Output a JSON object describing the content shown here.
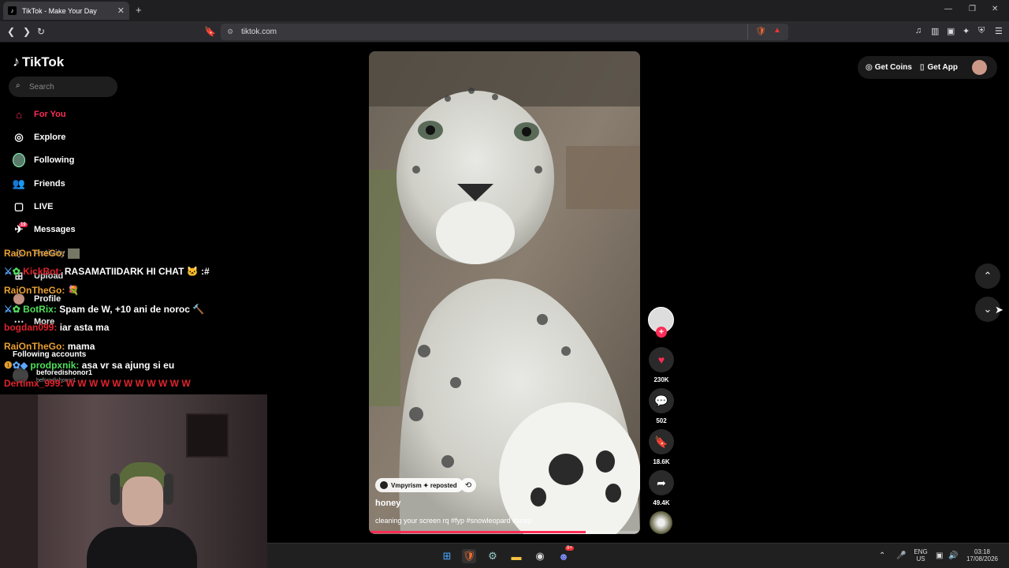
{
  "browser": {
    "tab_title": "TikTok - Make Your Day",
    "url": "tiktok.com"
  },
  "tiktok": {
    "logo": "TikTok",
    "search_placeholder": "Search",
    "nav": [
      {
        "label": "For You",
        "icon": "home-icon",
        "active": true
      },
      {
        "label": "Explore",
        "icon": "compass-icon"
      },
      {
        "label": "Following",
        "icon": "following-avatar-icon"
      },
      {
        "label": "Friends",
        "icon": "friends-icon"
      },
      {
        "label": "LIVE",
        "icon": "live-icon"
      },
      {
        "label": "Messages",
        "icon": "messages-icon",
        "badge": "19"
      },
      {
        "label": "Activity",
        "icon": "activity-icon"
      },
      {
        "label": "Upload",
        "icon": "upload-icon"
      },
      {
        "label": "Profile",
        "icon": "profile-icon"
      },
      {
        "label": "More",
        "icon": "more-icon"
      }
    ],
    "following_accounts_title": "Following accounts",
    "following_account_name": "beforedishonor1",
    "following_account_handle": "beforedishonor1",
    "top_right": {
      "coins": "Get Coins",
      "app": "Get App"
    },
    "video": {
      "repost_label": "Vmpyrism ✦ reposted",
      "author": "honey",
      "caption": "cleaning your screen rq #fyp #snowleopard #snep",
      "progress": 0.8
    },
    "actions": {
      "likes": "230K",
      "comments": "502",
      "saves": "18.6K",
      "shares": "49.4K"
    }
  },
  "chat": [
    {
      "user": "RaiOnTheGo:",
      "msg": "",
      "color": "orange"
    },
    {
      "user": "KickBot:",
      "msg": "RASAMATIIDARK HI CHAT 🐱 :#",
      "color": "red"
    },
    {
      "user": "RaiOnTheGo:",
      "msg": "💐",
      "color": "orange"
    },
    {
      "user": "BotRix:",
      "msg": "Spam de W, +10 ani de noroc 🔨",
      "color": "green"
    },
    {
      "user": "bogdan099:",
      "msg": "iar asta ma",
      "color": "red"
    },
    {
      "user": "RaiOnTheGo:",
      "msg": "mama",
      "color": "orange"
    },
    {
      "user": "prodpxnik:",
      "msg": "asa vr sa ajung si eu",
      "color": "blue"
    },
    {
      "user": "Dertimx_999:",
      "msg": "W W W W W W W W W W W",
      "color": "red"
    }
  ],
  "taskbar": {
    "lang": "ENG",
    "region": "US",
    "time": "03:18",
    "date": "17/08/2026",
    "discord_badge": "9+"
  }
}
